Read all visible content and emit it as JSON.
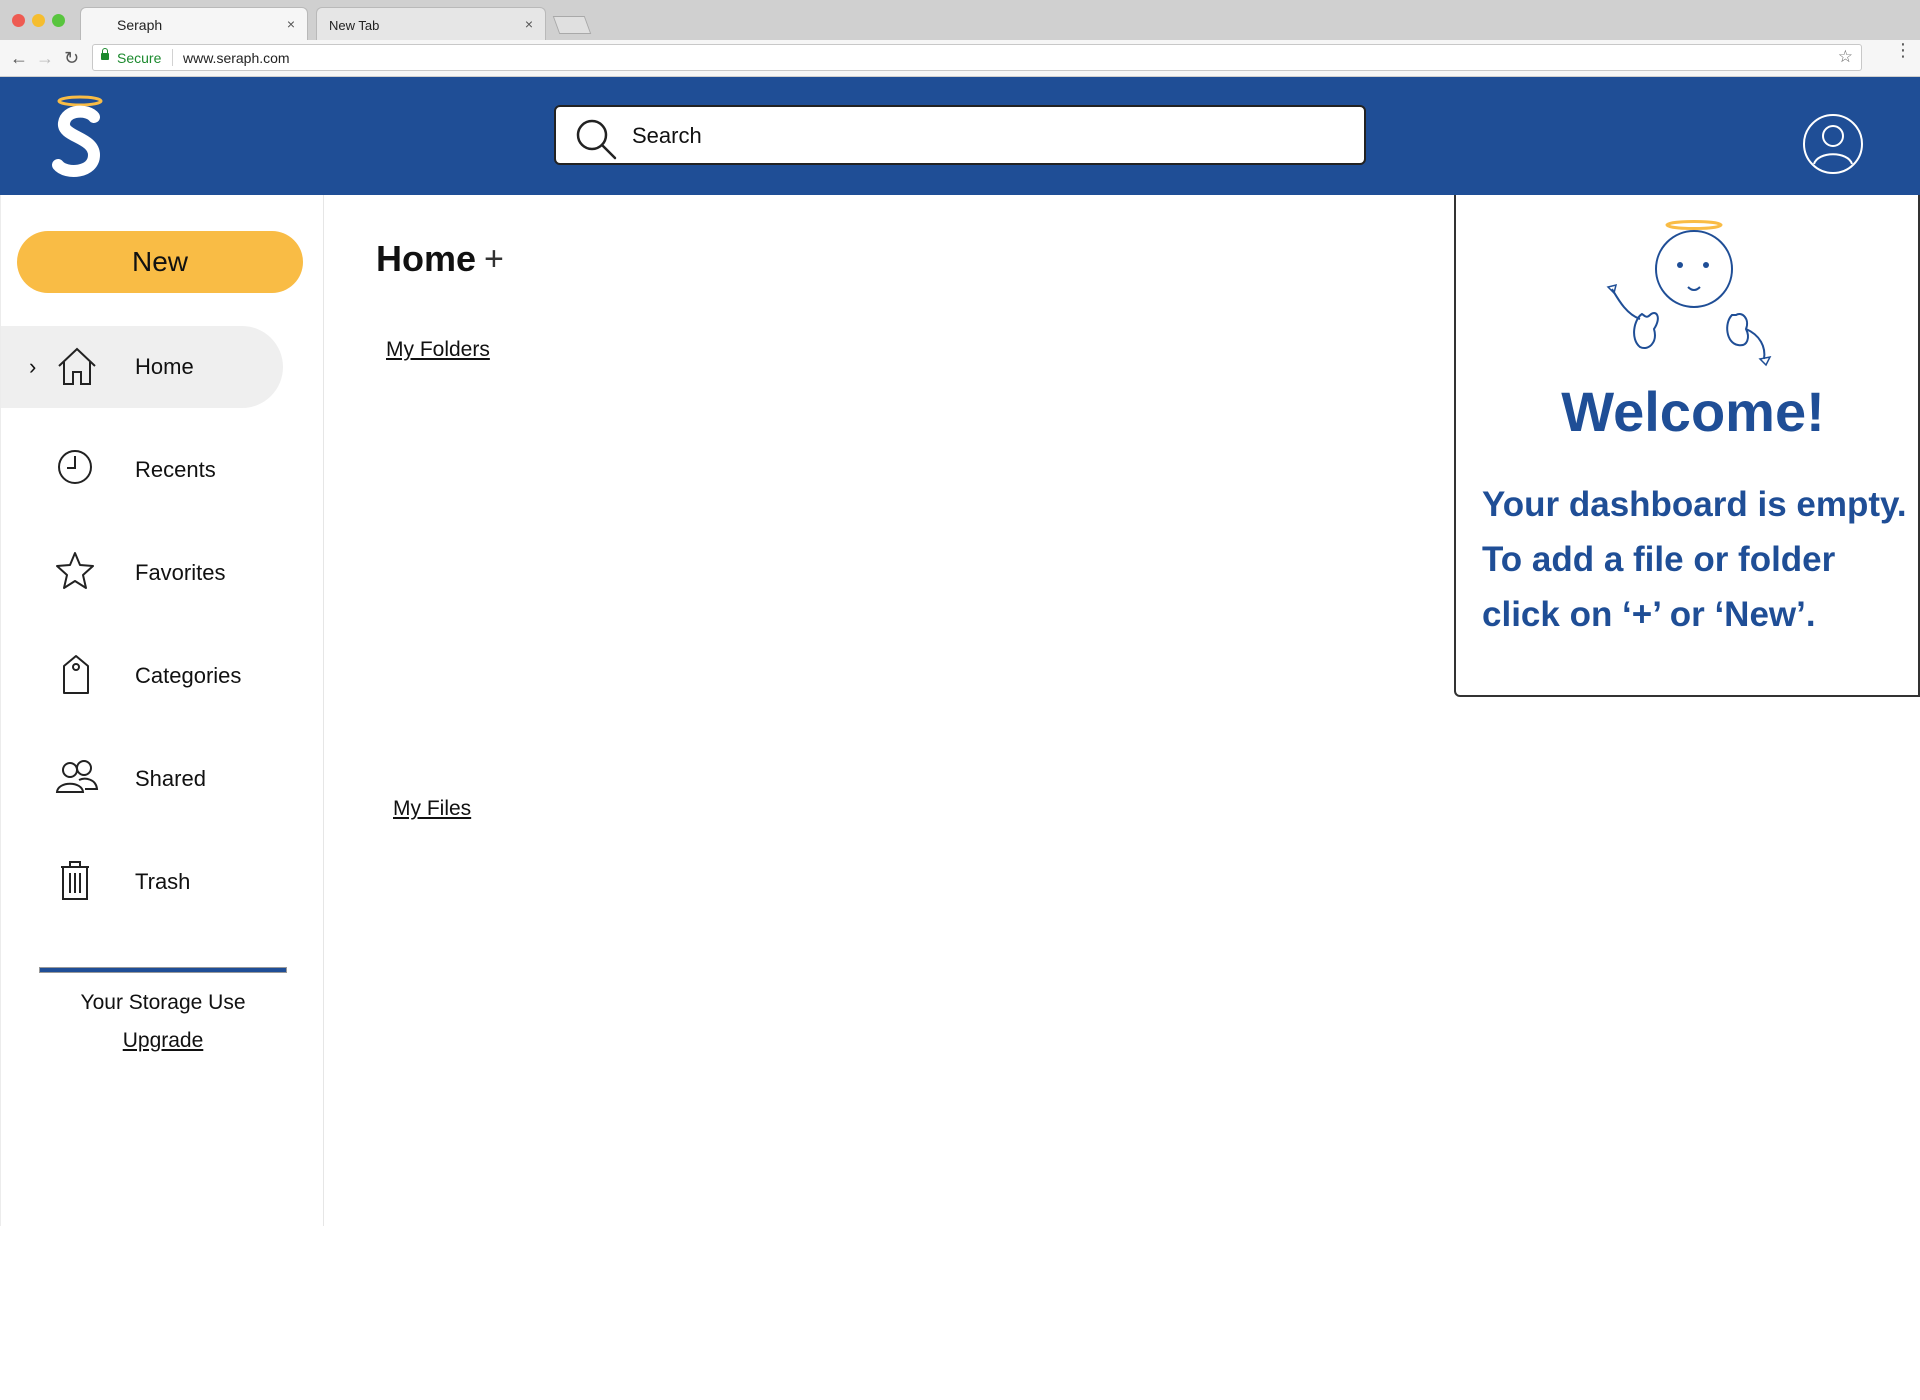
{
  "browser": {
    "tabs": [
      {
        "title": "Seraph",
        "close": "×"
      },
      {
        "title": "New Tab",
        "close": "×"
      }
    ],
    "secure_label": "Secure",
    "url": "www.seraph.com",
    "nav": {
      "back": "←",
      "forward": "→",
      "reload": "↻",
      "bookmark": "☆",
      "menu": "⋮"
    }
  },
  "header": {
    "search_placeholder": "Search"
  },
  "sidebar": {
    "new_label": "New",
    "items": [
      {
        "label": "Home",
        "icon": "home-icon",
        "active": true
      },
      {
        "label": "Recents",
        "icon": "clock-icon"
      },
      {
        "label": "Favorites",
        "icon": "star-icon"
      },
      {
        "label": "Categories",
        "icon": "tag-icon"
      },
      {
        "label": "Shared",
        "icon": "people-icon"
      },
      {
        "label": "Trash",
        "icon": "trash-icon"
      }
    ],
    "active_chevron": "›",
    "storage_label": "Your Storage Use",
    "upgrade_label": "Upgrade"
  },
  "main": {
    "title": "Home",
    "add_label": "+",
    "folders_label": "My Folders",
    "files_label": "My Files"
  },
  "welcome": {
    "title": "Welcome!",
    "lines": [
      "Your dashboard is empty.",
      "To add a file or folder",
      "click on ‘+’ or ‘New’."
    ]
  },
  "colors": {
    "brand_blue": "#1f4e96",
    "accent_yellow": "#f9bc45",
    "active_bg": "#efefef"
  }
}
